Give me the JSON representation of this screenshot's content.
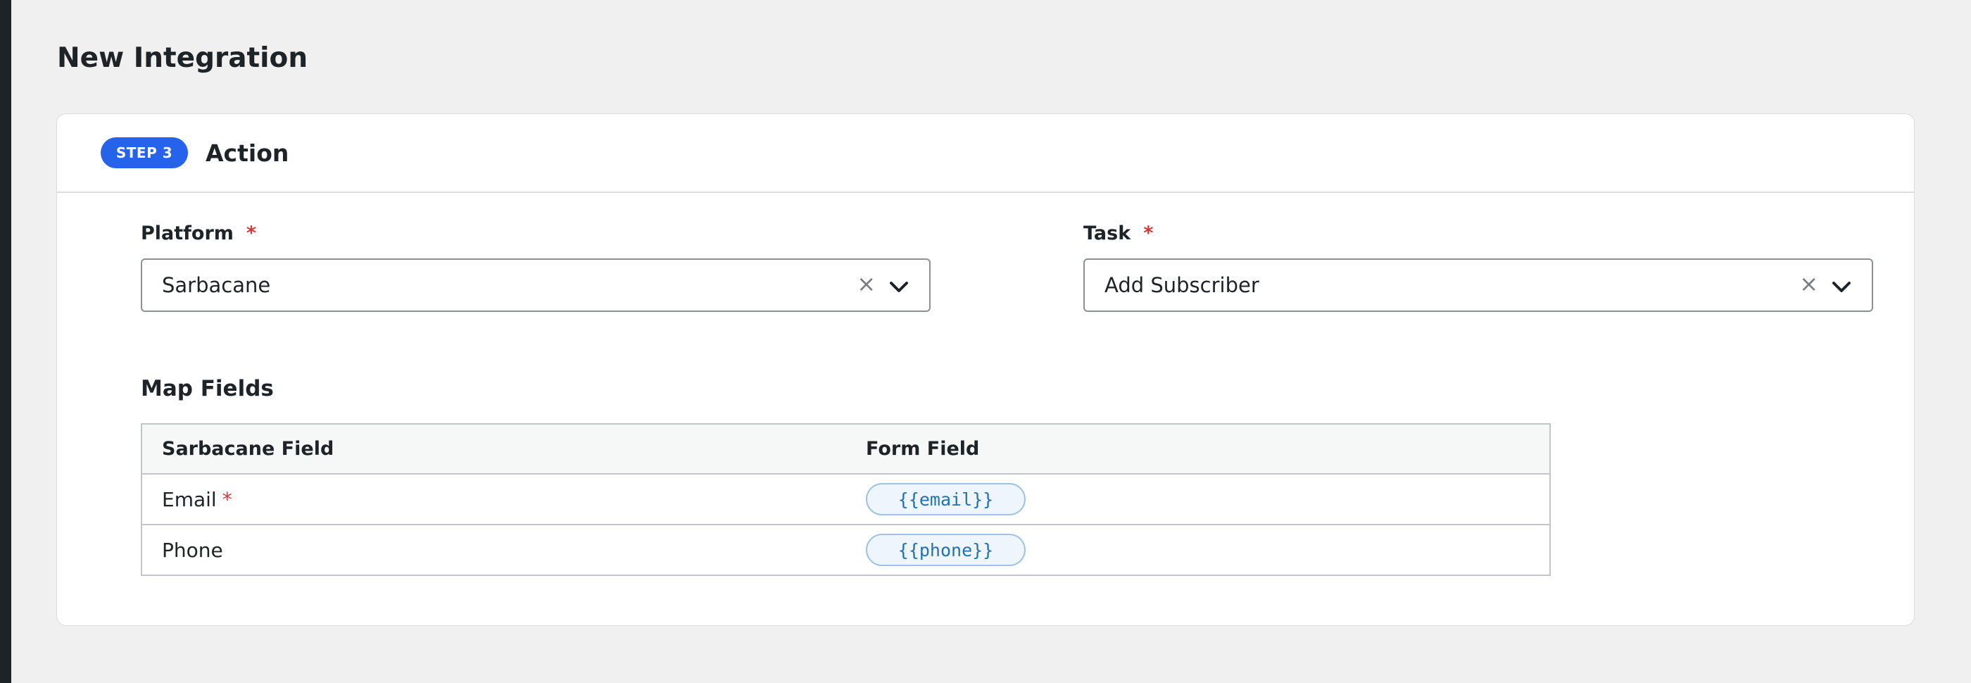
{
  "page": {
    "title": "New Integration"
  },
  "step": {
    "badge": "STEP 3",
    "title": "Action"
  },
  "platform": {
    "label": "Platform",
    "required_mark": "*",
    "value": "Sarbacane",
    "clear_icon": "close-icon",
    "toggle_icon": "chevron-down-icon"
  },
  "task": {
    "label": "Task",
    "required_mark": "*",
    "value": "Add Subscriber",
    "clear_icon": "close-icon",
    "toggle_icon": "chevron-down-icon"
  },
  "map_fields": {
    "heading": "Map Fields",
    "columns": [
      "Sarbacane Field",
      "Form Field"
    ],
    "rows": [
      {
        "field": "Email",
        "required_mark": "*",
        "token": "{{email}}"
      },
      {
        "field": "Phone",
        "required_mark": "",
        "token": "{{phone}}"
      }
    ]
  },
  "colors": {
    "accent": "#2563eb",
    "required": "#d63638",
    "token_text": "#2271b1"
  }
}
